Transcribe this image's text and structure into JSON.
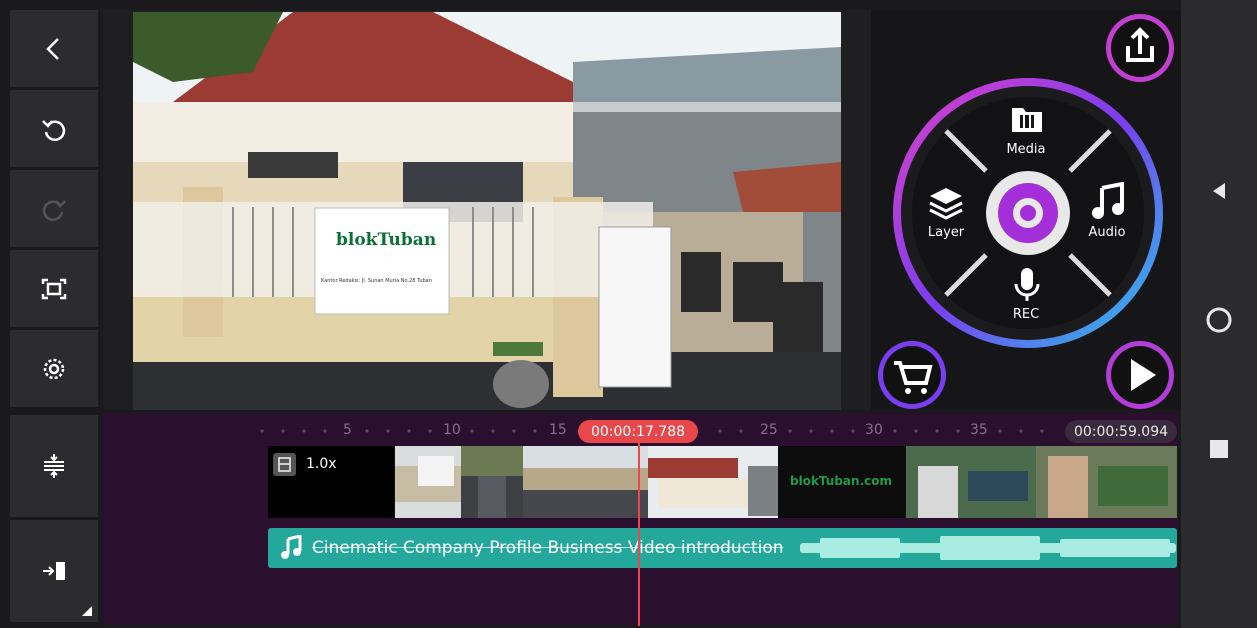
{
  "timeline": {
    "playhead_time": "00:00:17.788",
    "total_duration": "00:00:59.094",
    "ruler_marks": [
      "5",
      "10",
      "15",
      "25",
      "30",
      "35"
    ],
    "clip_speed": "1.0x",
    "audio_title": "Cinematic Company Profile Business Video introduction"
  },
  "preview": {
    "banner_brand": "blokTuban",
    "banner_address": "Kantor Redaksi: Jl. Sunan Muria No.28 Tuban"
  },
  "clips": {
    "brand_clip_text": "blokTuban.com"
  },
  "media_menu": {
    "top_label": "Media",
    "left_label": "Layer",
    "right_label": "Audio",
    "bottom_label": "REC"
  },
  "icons": {
    "back": "back-arrow-icon",
    "undo": "undo-icon",
    "redo": "redo-icon",
    "fit": "fit-screen-icon",
    "settings": "settings-icon",
    "adjust": "timeline-adjust-icon",
    "jump_end": "jump-to-end-icon",
    "export": "export-icon",
    "store": "store-cart-icon",
    "play": "play-icon"
  },
  "colors": {
    "playhead": "#e8474c",
    "audio_track": "#24a89b",
    "timeline_bg": "#2b0f2f",
    "menu_ring": "#9b3ce0"
  }
}
